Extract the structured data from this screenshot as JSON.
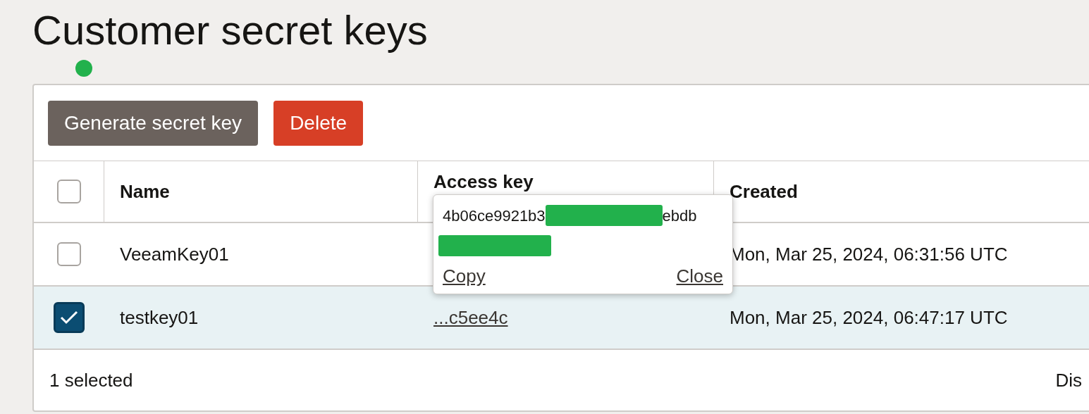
{
  "page": {
    "title": "Customer secret keys"
  },
  "toolbar": {
    "buttons": [
      {
        "label": "Generate secret key",
        "kind": "secondary"
      },
      {
        "label": "Delete",
        "kind": "danger"
      }
    ]
  },
  "table": {
    "select_all": {
      "checked": false
    },
    "columns": [
      "Name",
      "Access key",
      "Created"
    ],
    "rows": [
      {
        "selected": false,
        "name": "VeeamKey01",
        "created": "Mon, Mar 25, 2024, 06:31:56 UTC"
      },
      {
        "selected": true,
        "name": "testkey01",
        "access_key": "...c5ee4c",
        "created": "Mon, Mar 25, 2024, 06:47:17 UTC"
      }
    ]
  },
  "popover": {
    "key_start": "4b06ce9921b3",
    "key_end": "ebdb",
    "actions": [
      "Copy",
      "Close"
    ]
  },
  "footer": {
    "selection": "1 selected",
    "column_2": "Dis"
  }
}
